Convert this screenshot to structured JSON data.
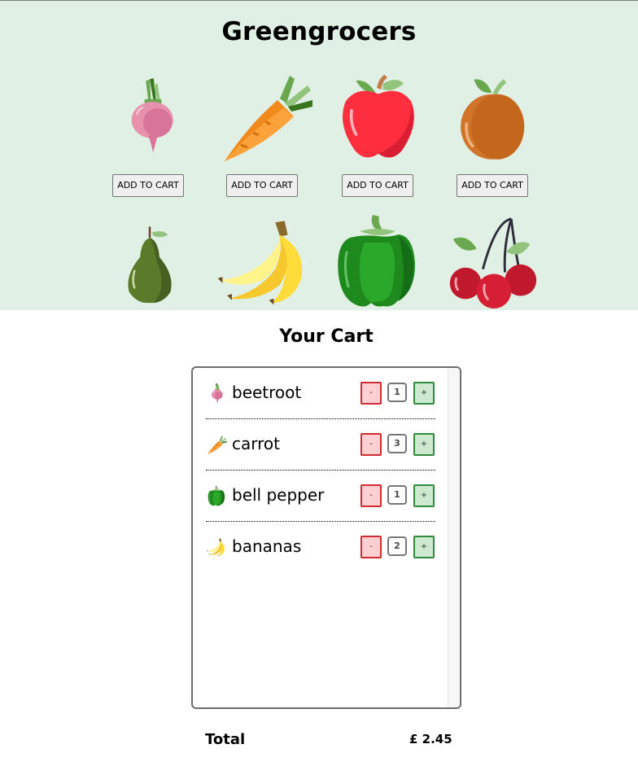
{
  "shop": {
    "title": "Greengrocers",
    "products": [
      {
        "name": "beetroot",
        "icon": "beetroot-icon",
        "button_label": "ADD TO CART"
      },
      {
        "name": "carrot",
        "icon": "carrot-icon",
        "button_label": "ADD TO CART"
      },
      {
        "name": "apple",
        "icon": "apple-icon",
        "button_label": "ADD TO CART"
      },
      {
        "name": "apricot",
        "icon": "apricot-icon",
        "button_label": "ADD TO CART"
      },
      {
        "name": "avocado",
        "icon": "avocado-icon"
      },
      {
        "name": "bananas",
        "icon": "bananas-icon"
      },
      {
        "name": "bell pepper",
        "icon": "bell-pepper-icon"
      },
      {
        "name": "cherry",
        "icon": "cherry-icon"
      }
    ]
  },
  "cart": {
    "title": "Your Cart",
    "minus_label": "-",
    "plus_label": "+",
    "items": [
      {
        "name": "beetroot",
        "icon": "beetroot-icon",
        "quantity": "1"
      },
      {
        "name": "carrot",
        "icon": "carrot-icon",
        "quantity": "3"
      },
      {
        "name": "bell pepper",
        "icon": "bell-pepper-icon",
        "quantity": "1"
      },
      {
        "name": "bananas",
        "icon": "bananas-icon",
        "quantity": "2"
      }
    ]
  },
  "totals": {
    "label": "Total",
    "value": "£ 2.45"
  },
  "colors": {
    "shop_background": "#e1f0e4",
    "minus_border": "#d22a33",
    "minus_fill": "#ffd0d2",
    "plus_border": "#2f8a3b",
    "plus_fill": "#cde9cf"
  }
}
